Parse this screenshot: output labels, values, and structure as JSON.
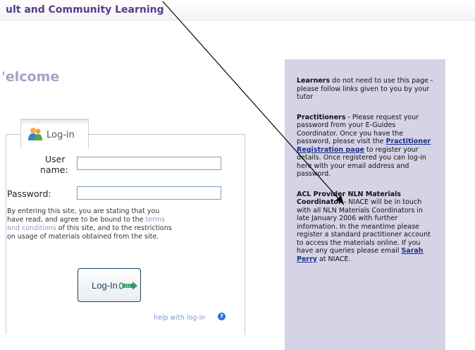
{
  "header": {
    "site_title": "ult and Community Learning"
  },
  "main": {
    "welcome": "'elcome"
  },
  "login": {
    "heading": "Log-in",
    "user_label_1": "User",
    "user_label_2": "name:",
    "password_label": "Password:",
    "username_value": "",
    "password_value": "",
    "terms_1": "By entering this site, you are stating that you",
    "terms_2a": "have read, and agree to be bound to the",
    "terms_link_a": "terms",
    "terms_link_b": "and conditions",
    "terms_3b": "of this site, and to the restrictions",
    "terms_4": "on usage of materials obtained from the site.",
    "button_label": "Log-In",
    "help_label": "help with log-in"
  },
  "info": {
    "p1_bold": "Learners",
    "p1_text": " do not need to use this page - please follow links given to you by your tutor",
    "p2_bold": "Practitioners",
    "p2_text_a": " - Please request your password from your E-Guides Coordinator. Once you have the password, please visit the ",
    "p2_link": "Practitioner Registration page",
    "p2_text_b": " to register your details. Once registered you can log-in here with your email address and password.",
    "p3_bold": "ACL Provider NLN Materials Coordinator",
    "p3_text_a": " - NIACE will be in touch with all NLN Materials Coordinators in late January 2006 with further information. In the meantime please register a standard practitioner account to access the materials online. If you have any queries please email ",
    "p3_link": "Sarah Perry",
    "p3_text_b": " at NIACE."
  },
  "icons": {
    "people": "people-icon",
    "arrow": "arrow-right-icon",
    "help": "help-icon"
  },
  "colors": {
    "title": "#5a3a8a",
    "welcome": "#a9a0c9",
    "info_panel": "#d6d3e6",
    "link": "#1a2f8a",
    "button_border": "#1f3f56"
  }
}
